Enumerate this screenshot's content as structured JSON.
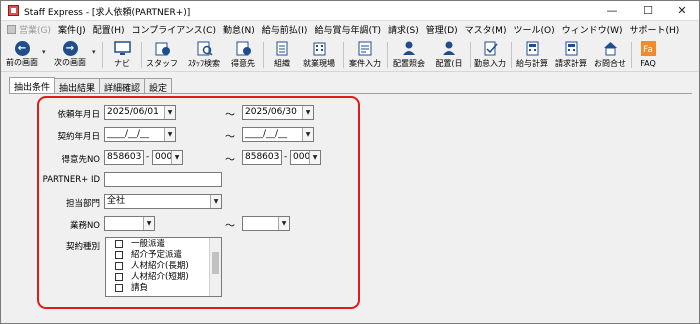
{
  "window": {
    "title": "Staff Express - [求人依頼(PARTNER+)]",
    "controls": {
      "minimize": "—",
      "maximize": "☐",
      "close": "✕"
    }
  },
  "menu": [
    {
      "label": "営業(G)",
      "disabled": true
    },
    {
      "label": "案件(J)",
      "disabled": false
    },
    {
      "label": "配置(H)",
      "disabled": false
    },
    {
      "label": "コンプライアンス(C)",
      "disabled": false
    },
    {
      "label": "勤怠(N)",
      "disabled": false
    },
    {
      "label": "給与前払(I)",
      "disabled": false
    },
    {
      "label": "給与賞与年調(T)",
      "disabled": false
    },
    {
      "label": "請求(S)",
      "disabled": false
    },
    {
      "label": "管理(D)",
      "disabled": false
    },
    {
      "label": "マスタ(M)",
      "disabled": false
    },
    {
      "label": "ツール(O)",
      "disabled": false
    },
    {
      "label": "ウィンドウ(W)",
      "disabled": false
    },
    {
      "label": "サポート(H)",
      "disabled": false
    }
  ],
  "toolbar": {
    "back": "前の画面",
    "forward": "次の画面",
    "navi": "ナビ",
    "staff": "スタッフ",
    "staff_search": "ｽﾀｯﾌ検索",
    "client": "得意先",
    "org": "組織",
    "site": "就業現場",
    "case_input": "案件入力",
    "placement_query": "配置照会",
    "placement_day": "配置(日",
    "attendance_input": "勤怠入力",
    "payroll": "給与計算",
    "billing": "請求計算",
    "contact": "お問合せ",
    "faq": "FAQ"
  },
  "tabs": [
    "抽出条件",
    "抽出結果",
    "詳細確認",
    "設定"
  ],
  "form": {
    "request_date_label": "依頼年月日",
    "request_date_from": "2025/06/01",
    "request_date_to": "2025/06/30",
    "contract_date_label": "契約年月日",
    "contract_date_from": "____/__/__",
    "contract_date_to": "____/__/__",
    "client_no_label": "得意先NO",
    "client_no_from": "858603",
    "client_no_from_sub": "000",
    "client_no_to": "858603",
    "client_no_to_sub": "000",
    "partner_id_label": "PARTNER+ ID",
    "partner_id_value": "",
    "dept_label": "担当部門",
    "dept_value": "全社",
    "job_no_label": "業務NO",
    "job_no_from": "",
    "job_no_to": "",
    "contract_type_label": "契約種別",
    "contract_types": [
      "一般派遣",
      "紹介予定派遣",
      "人材紹介(長期)",
      "人材紹介(短期)",
      "請負"
    ],
    "tilde": "～",
    "dash": "-"
  },
  "colors": {
    "highlight": "#e01b1b",
    "nav_icon": "#1f4e8c"
  }
}
